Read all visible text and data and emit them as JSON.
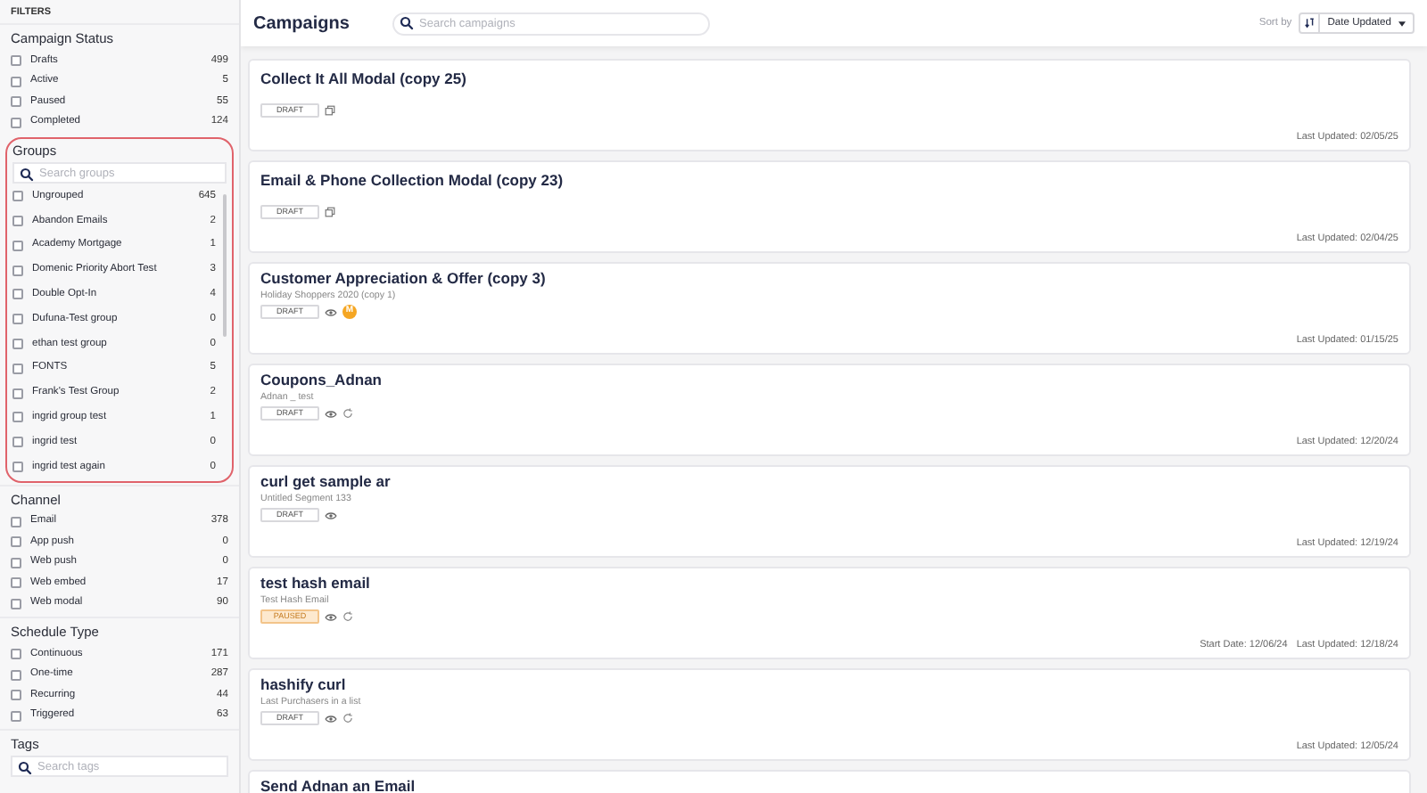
{
  "sidebar": {
    "title": "FILTERS",
    "sections": [
      {
        "kind": "plain",
        "heading": "Campaign Status",
        "items": [
          {
            "label": "Drafts",
            "count": "499",
            "checked": false
          },
          {
            "label": "Active",
            "count": "5",
            "checked": false
          },
          {
            "label": "Paused",
            "count": "55",
            "checked": false
          },
          {
            "label": "Completed",
            "count": "124",
            "checked": false
          }
        ]
      },
      {
        "kind": "highlighted",
        "heading": "Groups",
        "search_placeholder": "Search groups",
        "items": [
          {
            "label": "Ungrouped",
            "count": "645",
            "checked": false
          },
          {
            "label": "Abandon Emails",
            "count": "2",
            "checked": false
          },
          {
            "label": "Academy Mortgage",
            "count": "1",
            "checked": false
          },
          {
            "label": "Domenic Priority Abort Test",
            "count": "3",
            "checked": false
          },
          {
            "label": "Double Opt-In",
            "count": "4",
            "checked": false
          },
          {
            "label": "Dufuna-Test group",
            "count": "0",
            "checked": false
          },
          {
            "label": "ethan test group",
            "count": "0",
            "checked": false
          },
          {
            "label": "FONTS",
            "count": "5",
            "checked": false
          },
          {
            "label": "Frank's Test Group",
            "count": "2",
            "checked": false
          },
          {
            "label": "ingrid group test",
            "count": "1",
            "checked": false
          },
          {
            "label": "ingrid test",
            "count": "0",
            "checked": false
          },
          {
            "label": "ingrid test again",
            "count": "0",
            "checked": false
          }
        ]
      },
      {
        "kind": "plain",
        "heading": "Channel",
        "items": [
          {
            "label": "Email",
            "count": "378",
            "checked": false
          },
          {
            "label": "App push",
            "count": "0",
            "checked": false
          },
          {
            "label": "Web push",
            "count": "0",
            "checked": false
          },
          {
            "label": "Web embed",
            "count": "17",
            "checked": false
          },
          {
            "label": "Web modal",
            "count": "90",
            "checked": false
          }
        ]
      },
      {
        "kind": "plain",
        "heading": "Schedule Type",
        "items": [
          {
            "label": "Continuous",
            "count": "171",
            "checked": false
          },
          {
            "label": "One-time",
            "count": "287",
            "checked": false
          },
          {
            "label": "Recurring",
            "count": "44",
            "checked": false
          },
          {
            "label": "Triggered",
            "count": "63",
            "checked": false
          }
        ]
      },
      {
        "kind": "plain",
        "heading": "Tags",
        "search_placeholder": "Search tags"
      }
    ]
  },
  "header": {
    "title": "Campaigns",
    "search_placeholder": "Search campaigns",
    "sort_label": "Sort by",
    "sort_value": "Date Updated"
  },
  "campaigns": [
    {
      "title": "Collect It All Modal (copy 25)",
      "status": {
        "text": "DRAFT",
        "kind": "draft"
      },
      "icons": [
        {
          "kind": "copy"
        }
      ],
      "dates": [
        "Last Updated: 02/05/25"
      ]
    },
    {
      "title": "Email & Phone Collection Modal (copy 23)",
      "status": {
        "text": "DRAFT",
        "kind": "draft"
      },
      "icons": [
        {
          "kind": "copy"
        }
      ],
      "dates": [
        "Last Updated: 02/04/25"
      ]
    },
    {
      "title": "Customer Appreciation & Offer (copy 3)",
      "subtitle": "Holiday Shoppers 2020 (copy 1)",
      "status": {
        "text": "DRAFT",
        "kind": "draft"
      },
      "icons": [
        {
          "kind": "eye"
        },
        {
          "kind": "avatar",
          "text": "M"
        }
      ],
      "dates": [
        "Last Updated: 01/15/25"
      ]
    },
    {
      "title": "Coupons_Adnan",
      "subtitle": "Adnan _ test",
      "status": {
        "text": "DRAFT",
        "kind": "draft"
      },
      "icons": [
        {
          "kind": "eye"
        },
        {
          "kind": "refresh"
        }
      ],
      "dates": [
        "Last Updated: 12/20/24"
      ]
    },
    {
      "title": "curl get sample ar",
      "subtitle": "Untitled Segment 133",
      "status": {
        "text": "DRAFT",
        "kind": "draft"
      },
      "icons": [
        {
          "kind": "eye"
        }
      ],
      "dates": [
        "Last Updated: 12/19/24"
      ]
    },
    {
      "title": "test hash email",
      "subtitle": "Test Hash Email",
      "status": {
        "text": "PAUSED",
        "kind": "paused"
      },
      "icons": [
        {
          "kind": "eye"
        },
        {
          "kind": "refresh"
        }
      ],
      "dates": [
        "Start Date: 12/06/24",
        "Last Updated: 12/18/24"
      ]
    },
    {
      "title": "hashify curl",
      "subtitle": "Last Purchasers in a list",
      "status": {
        "text": "DRAFT",
        "kind": "draft"
      },
      "icons": [
        {
          "kind": "eye"
        },
        {
          "kind": "refresh"
        }
      ],
      "dates": [
        "Last Updated: 12/05/24"
      ]
    },
    {
      "title": "Send Adnan an Email"
    }
  ]
}
